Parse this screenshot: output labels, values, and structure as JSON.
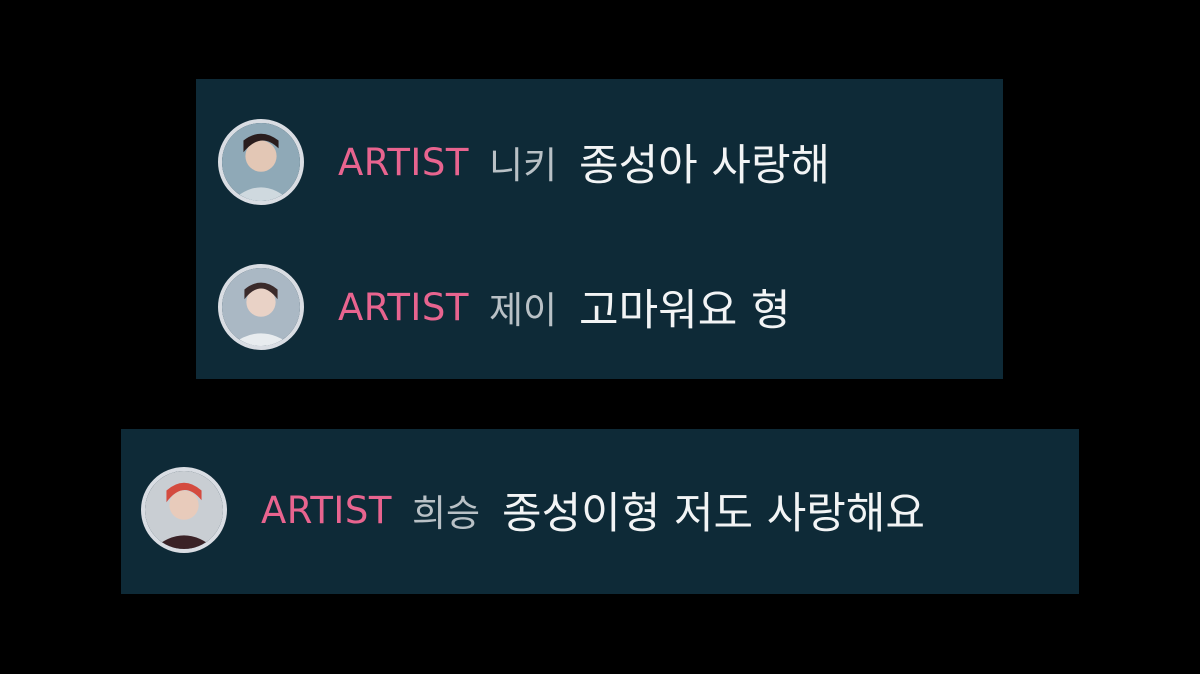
{
  "colors": {
    "page_background": "#000000",
    "panel_background": "#0e2a37",
    "artist_badge": "#e8648f",
    "nickname": "#b9c1c6",
    "message": "#f2f4f5",
    "avatar_border": "#d9dde3"
  },
  "comments": [
    {
      "badge": "ARTIST",
      "nickname": "니키",
      "message": "종성아 사랑해",
      "avatar_icon": "profile-photo-icon"
    },
    {
      "badge": "ARTIST",
      "nickname": "제이",
      "message": "고마워요 형",
      "avatar_icon": "profile-photo-icon"
    },
    {
      "badge": "ARTIST",
      "nickname": "희승",
      "message": "종성이형 저도 사랑해요",
      "avatar_icon": "profile-photo-icon"
    }
  ]
}
